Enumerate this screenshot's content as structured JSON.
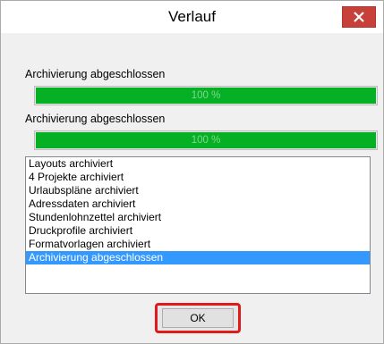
{
  "window": {
    "title": "Verlauf",
    "close_icon": "close-icon"
  },
  "progress_1": {
    "label": "Archivierung abgeschlossen",
    "value_text": "100 %",
    "value": 1.0
  },
  "progress_2": {
    "label": "Archivierung abgeschlossen",
    "value_text": "100 %",
    "value": 1.0
  },
  "log": {
    "items": [
      "Layouts archiviert",
      "4 Projekte archiviert",
      "Urlaubspläne archiviert",
      "Adressdaten archiviert",
      "Stundenlohnzettel archiviert",
      "Druckprofile archiviert",
      "Formatvorlagen archiviert",
      "Archivierung abgeschlossen"
    ],
    "selected_index": 7
  },
  "buttons": {
    "ok_label": "OK"
  },
  "colors": {
    "progress_fill": "#06b025",
    "selection": "#3399ff",
    "close_button": "#c7403a",
    "highlight_border": "#e0191f"
  }
}
